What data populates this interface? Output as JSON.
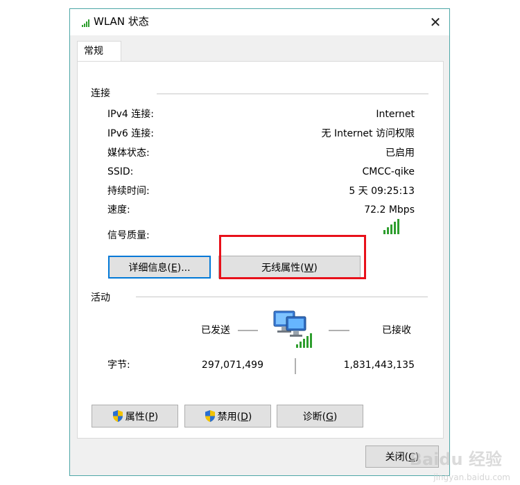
{
  "window": {
    "title": "WLAN 状态",
    "close_symbol": "✕"
  },
  "tab": {
    "label": "常规"
  },
  "connection": {
    "group_label": "连接",
    "rows": [
      {
        "label": "IPv4 连接:",
        "value": "Internet"
      },
      {
        "label": "IPv6 连接:",
        "value": "无 Internet 访问权限"
      },
      {
        "label": "媒体状态:",
        "value": "已启用"
      },
      {
        "label": "SSID:",
        "value": "CMCC-qike"
      },
      {
        "label": "持续时间:",
        "value": "5 天 09:25:13"
      },
      {
        "label": "速度:",
        "value": "72.2 Mbps"
      }
    ],
    "signal_label": "信号质量:",
    "signal_bars": 5,
    "details_button": {
      "text": "详细信息(",
      "key": "E",
      "suffix": ")..."
    },
    "wireless_button": {
      "text": "无线属性(",
      "key": "W",
      "suffix": ")"
    }
  },
  "activity": {
    "group_label": "活动",
    "sent_label": "已发送",
    "received_label": "已接收",
    "bytes_label": "字节:",
    "bytes_sent": "297,071,499",
    "bytes_received": "1,831,443,135"
  },
  "buttons": {
    "properties": {
      "text": "属性(",
      "key": "P",
      "suffix": ")"
    },
    "disable": {
      "text": "禁用(",
      "key": "D",
      "suffix": ")"
    },
    "diagnose": {
      "text": "诊断(",
      "key": "G",
      "suffix": ")"
    },
    "close": {
      "text": "关闭(",
      "key": "C",
      "suffix": ")"
    }
  },
  "watermark": {
    "main": "Baidu 经验",
    "sub": "jingyan.baidu.com"
  },
  "colors": {
    "highlight": "#e8101a",
    "signal_green": "#2e9e2e",
    "focus_blue": "#0078d7"
  }
}
